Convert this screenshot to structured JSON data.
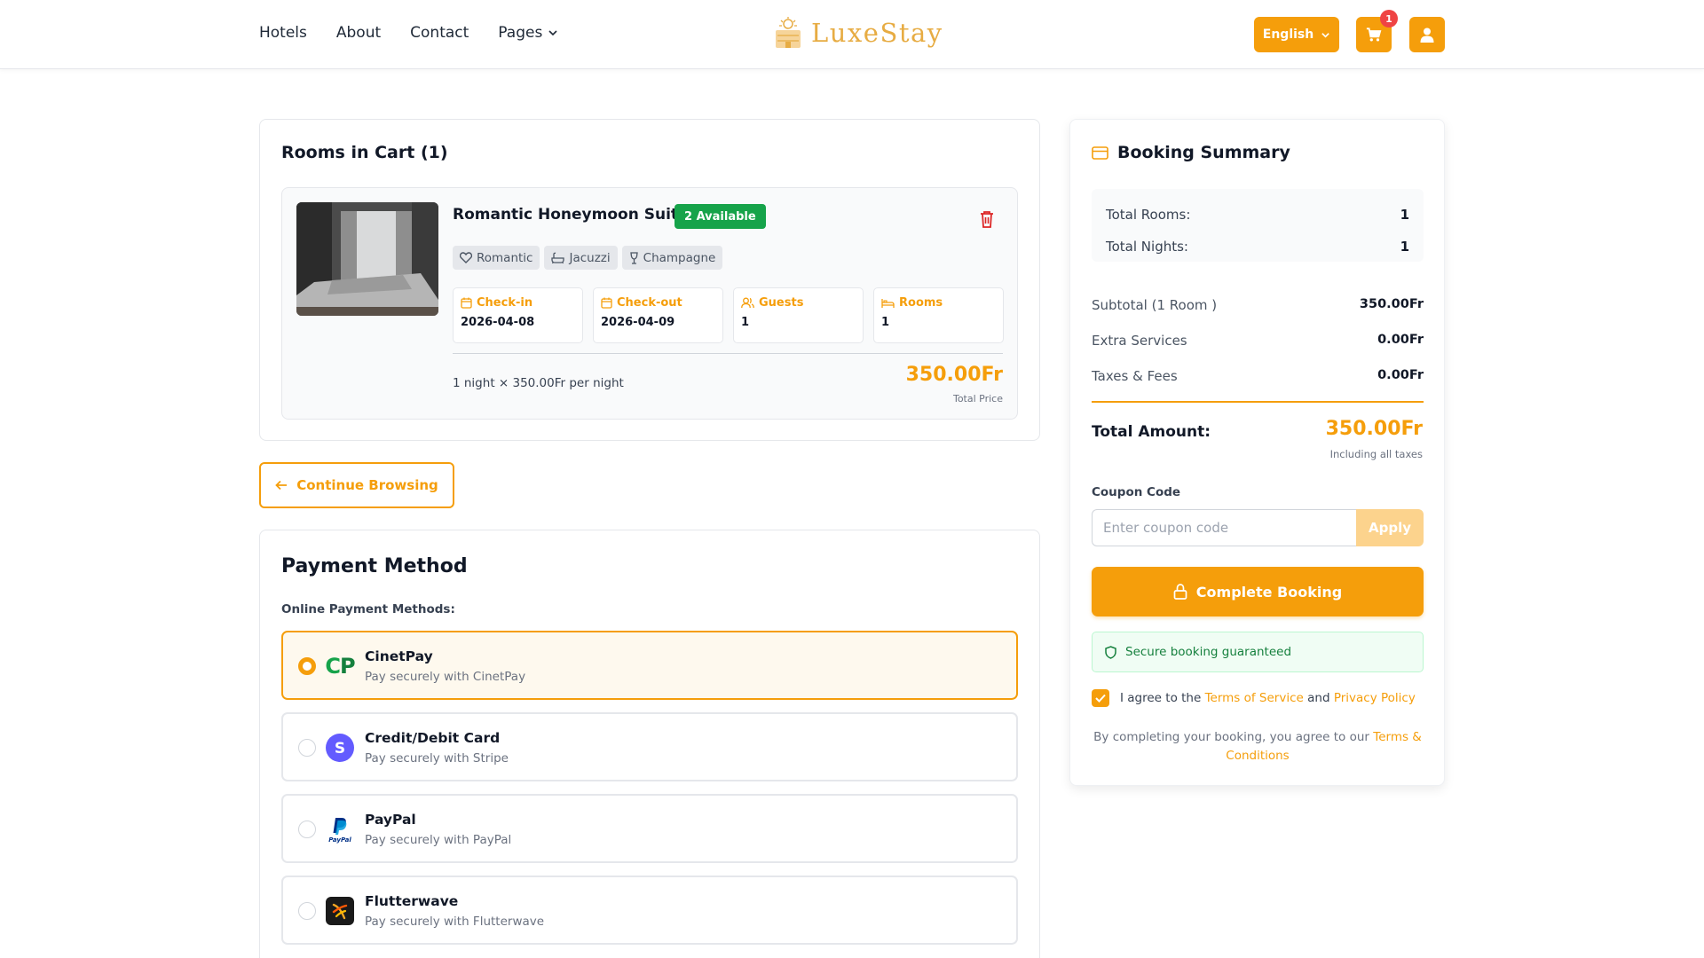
{
  "header": {
    "nav": [
      "Hotels",
      "About",
      "Contact",
      "Pages"
    ],
    "logo_text": "LuxeStay",
    "language": "English",
    "cart_count": "1",
    "accent_color": "#f59e0b"
  },
  "cart": {
    "title": "Rooms in Cart (1)",
    "room": {
      "name": "Romantic Honeymoon Suite",
      "availability": "2 Available",
      "tags": [
        "Romantic",
        "Jacuzzi",
        "Champagne"
      ],
      "info": [
        {
          "label": "Check-in",
          "value": "2026-04-08",
          "icon": "calendar-icon"
        },
        {
          "label": "Check-out",
          "value": "2026-04-09",
          "icon": "calendar-icon"
        },
        {
          "label": "Guests",
          "value": "1",
          "icon": "users-icon"
        },
        {
          "label": "Rooms",
          "value": "1",
          "icon": "bed-icon"
        }
      ],
      "night_text": "1 night × 350.00Fr per night",
      "price": "350.00Fr",
      "price_label": "Total Price"
    }
  },
  "continue_label": "Continue Browsing",
  "payment": {
    "title": "Payment Method",
    "subtitle": "Online Payment Methods:",
    "options": [
      {
        "name": "CinetPay",
        "desc": "Pay securely with CinetPay",
        "selected": true
      },
      {
        "name": "Credit/Debit Card",
        "desc": "Pay securely with Stripe",
        "selected": false
      },
      {
        "name": "PayPal",
        "desc": "Pay securely with PayPal",
        "selected": false
      },
      {
        "name": "Flutterwave",
        "desc": "Pay securely with Flutterwave",
        "selected": false
      }
    ]
  },
  "summary": {
    "title": "Booking Summary",
    "total_rooms_label": "Total Rooms:",
    "total_rooms": "1",
    "total_nights_label": "Total Nights:",
    "total_nights": "1",
    "subtotal_label": "Subtotal (1 Room )",
    "subtotal": "350.00Fr",
    "extra_label": "Extra Services",
    "extra": "0.00Fr",
    "taxes_label": "Taxes & Fees",
    "taxes": "0.00Fr",
    "total_label": "Total Amount:",
    "total": "350.00Fr",
    "total_note": "Including all taxes",
    "coupon_label": "Coupon Code",
    "coupon_placeholder": "Enter coupon code",
    "apply_label": "Apply",
    "complete_label": "Complete Booking",
    "secure_text": "Secure booking guaranteed",
    "agree_prefix": "I agree to the",
    "terms_link": "Terms of Service",
    "agree_and": "and",
    "privacy_link": "Privacy Policy",
    "fine_prefix": "By completing your booking, you agree to our",
    "fine_link": "Terms & Conditions"
  }
}
